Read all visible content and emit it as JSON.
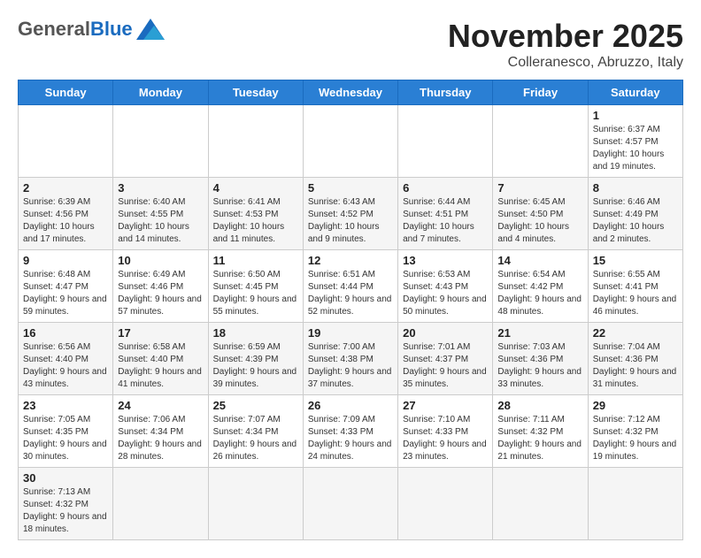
{
  "header": {
    "logo_general": "General",
    "logo_blue": "Blue",
    "month_title": "November 2025",
    "location": "Colleranesco, Abruzzo, Italy"
  },
  "weekdays": [
    "Sunday",
    "Monday",
    "Tuesday",
    "Wednesday",
    "Thursday",
    "Friday",
    "Saturday"
  ],
  "weeks": [
    [
      {
        "day": "",
        "info": ""
      },
      {
        "day": "",
        "info": ""
      },
      {
        "day": "",
        "info": ""
      },
      {
        "day": "",
        "info": ""
      },
      {
        "day": "",
        "info": ""
      },
      {
        "day": "",
        "info": ""
      },
      {
        "day": "1",
        "info": "Sunrise: 6:37 AM\nSunset: 4:57 PM\nDaylight: 10 hours and 19 minutes."
      }
    ],
    [
      {
        "day": "2",
        "info": "Sunrise: 6:39 AM\nSunset: 4:56 PM\nDaylight: 10 hours and 17 minutes."
      },
      {
        "day": "3",
        "info": "Sunrise: 6:40 AM\nSunset: 4:55 PM\nDaylight: 10 hours and 14 minutes."
      },
      {
        "day": "4",
        "info": "Sunrise: 6:41 AM\nSunset: 4:53 PM\nDaylight: 10 hours and 11 minutes."
      },
      {
        "day": "5",
        "info": "Sunrise: 6:43 AM\nSunset: 4:52 PM\nDaylight: 10 hours and 9 minutes."
      },
      {
        "day": "6",
        "info": "Sunrise: 6:44 AM\nSunset: 4:51 PM\nDaylight: 10 hours and 7 minutes."
      },
      {
        "day": "7",
        "info": "Sunrise: 6:45 AM\nSunset: 4:50 PM\nDaylight: 10 hours and 4 minutes."
      },
      {
        "day": "8",
        "info": "Sunrise: 6:46 AM\nSunset: 4:49 PM\nDaylight: 10 hours and 2 minutes."
      }
    ],
    [
      {
        "day": "9",
        "info": "Sunrise: 6:48 AM\nSunset: 4:47 PM\nDaylight: 9 hours and 59 minutes."
      },
      {
        "day": "10",
        "info": "Sunrise: 6:49 AM\nSunset: 4:46 PM\nDaylight: 9 hours and 57 minutes."
      },
      {
        "day": "11",
        "info": "Sunrise: 6:50 AM\nSunset: 4:45 PM\nDaylight: 9 hours and 55 minutes."
      },
      {
        "day": "12",
        "info": "Sunrise: 6:51 AM\nSunset: 4:44 PM\nDaylight: 9 hours and 52 minutes."
      },
      {
        "day": "13",
        "info": "Sunrise: 6:53 AM\nSunset: 4:43 PM\nDaylight: 9 hours and 50 minutes."
      },
      {
        "day": "14",
        "info": "Sunrise: 6:54 AM\nSunset: 4:42 PM\nDaylight: 9 hours and 48 minutes."
      },
      {
        "day": "15",
        "info": "Sunrise: 6:55 AM\nSunset: 4:41 PM\nDaylight: 9 hours and 46 minutes."
      }
    ],
    [
      {
        "day": "16",
        "info": "Sunrise: 6:56 AM\nSunset: 4:40 PM\nDaylight: 9 hours and 43 minutes."
      },
      {
        "day": "17",
        "info": "Sunrise: 6:58 AM\nSunset: 4:40 PM\nDaylight: 9 hours and 41 minutes."
      },
      {
        "day": "18",
        "info": "Sunrise: 6:59 AM\nSunset: 4:39 PM\nDaylight: 9 hours and 39 minutes."
      },
      {
        "day": "19",
        "info": "Sunrise: 7:00 AM\nSunset: 4:38 PM\nDaylight: 9 hours and 37 minutes."
      },
      {
        "day": "20",
        "info": "Sunrise: 7:01 AM\nSunset: 4:37 PM\nDaylight: 9 hours and 35 minutes."
      },
      {
        "day": "21",
        "info": "Sunrise: 7:03 AM\nSunset: 4:36 PM\nDaylight: 9 hours and 33 minutes."
      },
      {
        "day": "22",
        "info": "Sunrise: 7:04 AM\nSunset: 4:36 PM\nDaylight: 9 hours and 31 minutes."
      }
    ],
    [
      {
        "day": "23",
        "info": "Sunrise: 7:05 AM\nSunset: 4:35 PM\nDaylight: 9 hours and 30 minutes."
      },
      {
        "day": "24",
        "info": "Sunrise: 7:06 AM\nSunset: 4:34 PM\nDaylight: 9 hours and 28 minutes."
      },
      {
        "day": "25",
        "info": "Sunrise: 7:07 AM\nSunset: 4:34 PM\nDaylight: 9 hours and 26 minutes."
      },
      {
        "day": "26",
        "info": "Sunrise: 7:09 AM\nSunset: 4:33 PM\nDaylight: 9 hours and 24 minutes."
      },
      {
        "day": "27",
        "info": "Sunrise: 7:10 AM\nSunset: 4:33 PM\nDaylight: 9 hours and 23 minutes."
      },
      {
        "day": "28",
        "info": "Sunrise: 7:11 AM\nSunset: 4:32 PM\nDaylight: 9 hours and 21 minutes."
      },
      {
        "day": "29",
        "info": "Sunrise: 7:12 AM\nSunset: 4:32 PM\nDaylight: 9 hours and 19 minutes."
      }
    ],
    [
      {
        "day": "30",
        "info": "Sunrise: 7:13 AM\nSunset: 4:32 PM\nDaylight: 9 hours and 18 minutes."
      },
      {
        "day": "",
        "info": ""
      },
      {
        "day": "",
        "info": ""
      },
      {
        "day": "",
        "info": ""
      },
      {
        "day": "",
        "info": ""
      },
      {
        "day": "",
        "info": ""
      },
      {
        "day": "",
        "info": ""
      }
    ]
  ]
}
